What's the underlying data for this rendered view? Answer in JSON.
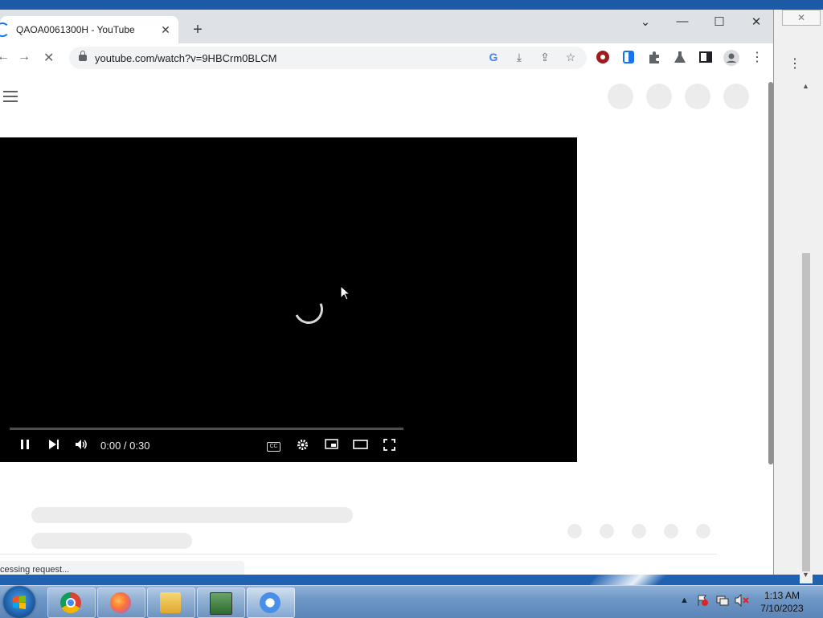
{
  "tab": {
    "title": "QAOA0061300H - YouTube",
    "close_glyph": "✕",
    "new_tab_glyph": "+"
  },
  "window_controls": {
    "tab_search": "⌄",
    "minimize": "—",
    "maximize": "☐",
    "close": "✕"
  },
  "toolbar": {
    "back_glyph": "←",
    "forward_glyph": "→",
    "stop_glyph": "✕",
    "url": "youtube.com/watch?v=9HBCrm0BLCM",
    "menu_glyph": "⋮"
  },
  "player": {
    "time": "0:00 / 0:30",
    "progress": 0
  },
  "status": {
    "text": "cessing request..."
  },
  "background_window": {
    "close_glyph": "✕",
    "menu_glyph": "⋮"
  },
  "taskbar": {
    "clock_time": "1:13 AM",
    "clock_date": "7/10/2023",
    "apps": [
      "chrome",
      "firefox",
      "file-explorer",
      "task-manager",
      "chromium"
    ]
  },
  "colors": {
    "chrome_blue": "#1a73e8",
    "player_bg": "#000000",
    "skeleton": "#ececec"
  }
}
